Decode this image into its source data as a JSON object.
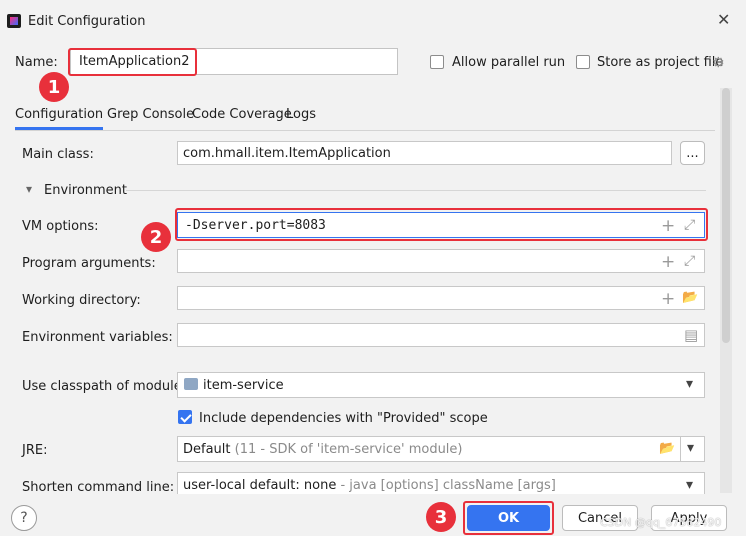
{
  "window": {
    "title": "Edit Configuration"
  },
  "header": {
    "name_label": "Name:",
    "name_value": "ItemApplication2",
    "allow_parallel_label": "Allow parallel run",
    "allow_parallel_checked": false,
    "store_project_label": "Store as project file",
    "store_project_checked": false
  },
  "tabs": [
    {
      "label": "Configuration",
      "active": true
    },
    {
      "label": "Grep Console",
      "active": false
    },
    {
      "label": "Code Coverage",
      "active": false
    },
    {
      "label": "Logs",
      "active": false
    }
  ],
  "form": {
    "main_class_label": "Main class:",
    "main_class_value": "com.hmall.item.ItemApplication",
    "main_class_browse": "...",
    "environment_label": "Environment",
    "vm_options_label": "VM options:",
    "vm_options_value": "-Dserver.port=8083",
    "program_args_label": "Program arguments:",
    "program_args_value": "",
    "working_dir_label": "Working directory:",
    "working_dir_value": "",
    "env_vars_label": "Environment variables:",
    "env_vars_value": "",
    "classpath_label": "Use classpath of module:",
    "classpath_value": "item-service",
    "include_deps_label": "Include dependencies with \"Provided\" scope",
    "include_deps_checked": true,
    "jre_label": "JRE:",
    "jre_value": "Default",
    "jre_detail": "(11 - SDK of 'item-service' module)",
    "shorten_label": "Shorten command line:",
    "shorten_value": "user-local default: none",
    "shorten_detail": "- java [options] className [args]"
  },
  "annotations": {
    "badge1": "1",
    "badge2": "2",
    "badge3": "3"
  },
  "footer": {
    "help": "?",
    "ok": "OK",
    "cancel": "Cancel",
    "apply": "Apply",
    "watermark": "CSDN @qq_67562490"
  },
  "icons": {
    "plus": "+",
    "expand": "⤢",
    "folder": "📂",
    "doc": "▤",
    "dropdown": "▾",
    "section_arrow": "▾",
    "gear": "⚙",
    "close": "✕"
  },
  "colors": {
    "accent": "#3574f0",
    "annotation": "#e8303b"
  }
}
